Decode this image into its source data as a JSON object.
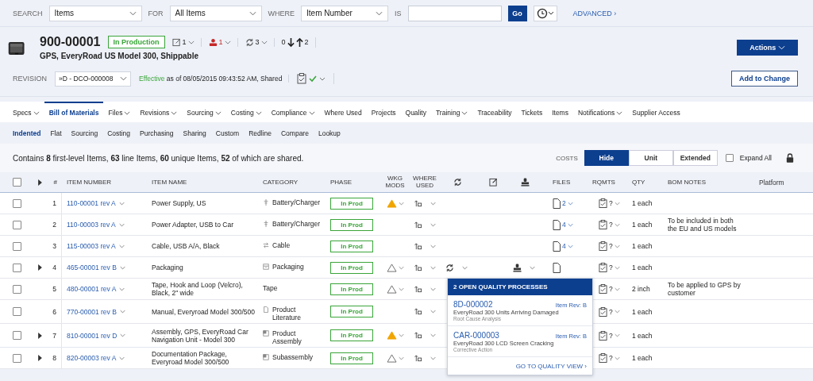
{
  "search": {
    "fields": [
      {
        "label": "SEARCH",
        "value": "Items"
      },
      {
        "label": "FOR",
        "value": "All Items"
      },
      {
        "label": "WHERE",
        "value": "Item Number"
      }
    ],
    "last_label": "IS",
    "go": "Go",
    "advanced": "ADVANCED ›"
  },
  "item": {
    "number": "900-00001",
    "phase": "In Production",
    "name": "GPS, EveryRoad US Model 300, Shippable",
    "changes": "1",
    "people": "1",
    "quality": "3",
    "used_down": "0",
    "used_up": "2",
    "actions": "Actions",
    "revision_label": "REVISION",
    "revision": "»D - DCO-000008",
    "effective": "Effective",
    "effective_rest": "as of 08/05/2015 09:43:52 AM, Shared",
    "add_to_change": "Add to Change"
  },
  "tabs": [
    {
      "label": "Specs",
      "menu": true,
      "selected": false
    },
    {
      "label": "Bill of Materials",
      "menu": false,
      "selected": true
    },
    {
      "label": "Files",
      "menu": true,
      "selected": false
    },
    {
      "label": "Revisions",
      "menu": true,
      "selected": false
    },
    {
      "label": "Sourcing",
      "menu": true,
      "selected": false
    },
    {
      "label": "Costing",
      "menu": true,
      "selected": false
    },
    {
      "label": "Compliance",
      "menu": true,
      "selected": false
    },
    {
      "label": "Where Used",
      "menu": false,
      "selected": false
    },
    {
      "label": "Projects",
      "menu": false,
      "selected": false
    },
    {
      "label": "Quality",
      "menu": false,
      "selected": false
    },
    {
      "label": "Training",
      "menu": true,
      "selected": false
    },
    {
      "label": "Traceability",
      "menu": false,
      "selected": false
    },
    {
      "label": "Tickets",
      "menu": false,
      "selected": false
    },
    {
      "label": "Items",
      "menu": false,
      "selected": false
    },
    {
      "label": "Notifications",
      "menu": true,
      "selected": false
    },
    {
      "label": "Supplier Access",
      "menu": false,
      "selected": false
    }
  ],
  "subtabs": [
    {
      "label": "Indented",
      "selected": true
    },
    {
      "label": "Flat",
      "selected": false
    },
    {
      "label": "Sourcing",
      "selected": false
    },
    {
      "label": "Costing",
      "selected": false
    },
    {
      "label": "Purchasing",
      "selected": false
    },
    {
      "label": "Sharing",
      "selected": false
    },
    {
      "label": "Custom",
      "selected": false
    },
    {
      "label": "Redline",
      "selected": false
    },
    {
      "label": "Compare",
      "selected": false
    },
    {
      "label": "Lookup",
      "selected": false
    }
  ],
  "summary": "Contains **8** first-level Items, **63** line Items, **60** unique Items, **52** of which are shared.",
  "costs": {
    "label": "COSTS",
    "options": [
      {
        "label": "Hide",
        "selected": true
      },
      {
        "label": "Unit",
        "selected": false
      },
      {
        "label": "Extended",
        "selected": false
      }
    ]
  },
  "expand_all": {
    "label": "Expand All",
    "checked": false
  },
  "table": {
    "select_all": false,
    "columns": [
      "#",
      "ITEM NUMBER",
      "ITEM NAME",
      "CATEGORY",
      "PHASE",
      "WKG MODS",
      "WHERE USED",
      "FILES",
      "RQMTS",
      "QTY",
      "BOM NOTES",
      "Platform"
    ],
    "rows": [
      {
        "checked": false,
        "expandable": false,
        "number": "1",
        "item_number": "110-00001 rev A",
        "name": "Power Supply, US",
        "category": {
          "kind": "plug",
          "label": "Battery/Charger"
        },
        "phase": "In Prod",
        "mods": {
          "kind": "alert"
        },
        "file": true,
        "file_count": "2",
        "rqmts": "?",
        "qty": "1 each"
      },
      {
        "checked": false,
        "expandable": false,
        "number": "2",
        "item_number": "110-00003 rev A",
        "name": "Power Adapter, USB to Car",
        "category": {
          "kind": "plug",
          "label": "Battery/Charger"
        },
        "phase": "In Prod",
        "file": true,
        "file_count": "4",
        "rqmts": "?",
        "qty": "1 each",
        "notes": "To be included in both the EU and US models"
      },
      {
        "checked": false,
        "expandable": false,
        "number": "3",
        "item_number": "115-00003 rev A",
        "name": "Cable, USB A/A, Black",
        "category": {
          "kind": "cable",
          "label": "Cable"
        },
        "phase": "In Prod",
        "file": true,
        "file_count": "4",
        "rqmts": "?",
        "qty": "1 each"
      },
      {
        "checked": false,
        "expandable": true,
        "number": "4",
        "item_number": "465-00001 rev B",
        "name": "Packaging",
        "category": {
          "kind": "box",
          "label": "Packaging"
        },
        "phase": "In Prod",
        "mods": {
          "kind": "open"
        },
        "quality_menu": true,
        "stamp_menu": true,
        "file": true,
        "rqmts": "?",
        "qty": "1 each"
      },
      {
        "checked": false,
        "expandable": false,
        "number": "5",
        "item_number": "480-00001 rev A",
        "name": "Tape, Hook and Loop (Velcro), Black, 2\" wide",
        "category": {
          "kind": "none",
          "label": "Tape"
        },
        "phase": "In Prod",
        "mods": {
          "kind": "open"
        },
        "rqmts": "?",
        "qty": "2 inch",
        "notes": "To be applied to GPS by customer"
      },
      {
        "checked": false,
        "expandable": false,
        "number": "6",
        "item_number": "770-00001 rev B",
        "name": "Manual, Everyroad Model 300/500",
        "category": {
          "kind": "doc",
          "label": "Product Literature"
        },
        "phase": "In Prod",
        "rqmts": "?",
        "qty": "1 each"
      },
      {
        "checked": false,
        "expandable": true,
        "number": "7",
        "item_number": "810-00001 rev D",
        "name": "Assembly, GPS, EveryRoad Car Navigation Unit - Model 300",
        "category": {
          "kind": "assembly",
          "label": "Product Assembly"
        },
        "phase": "In Prod",
        "mods": {
          "kind": "alert"
        },
        "rqmts": "?",
        "qty": "1 each"
      },
      {
        "checked": false,
        "expandable": true,
        "number": "8",
        "item_number": "820-00003 rev A",
        "name": "Documentation Package, Everyroad Model 300/500",
        "category": {
          "kind": "assembly",
          "label": "Subassembly"
        },
        "phase": "In Prod",
        "mods": {
          "kind": "open"
        },
        "rqmts": "?",
        "qty": "1 each"
      }
    ]
  },
  "popup": {
    "title": "2 OPEN QUALITY PROCESSES",
    "items": [
      {
        "id": "8D-000002",
        "rev": "Item Rev: B",
        "title": "EveryRoad 300 Units Arriving Damaged",
        "type": "Root Cause Analysis"
      },
      {
        "id": "CAR-000003",
        "rev": "Item Rev: B",
        "title": "EveryRoad 300 LCD Screen Cracking",
        "type": "Corrective Action"
      }
    ],
    "link": "GO TO QUALITY VIEW ›"
  }
}
